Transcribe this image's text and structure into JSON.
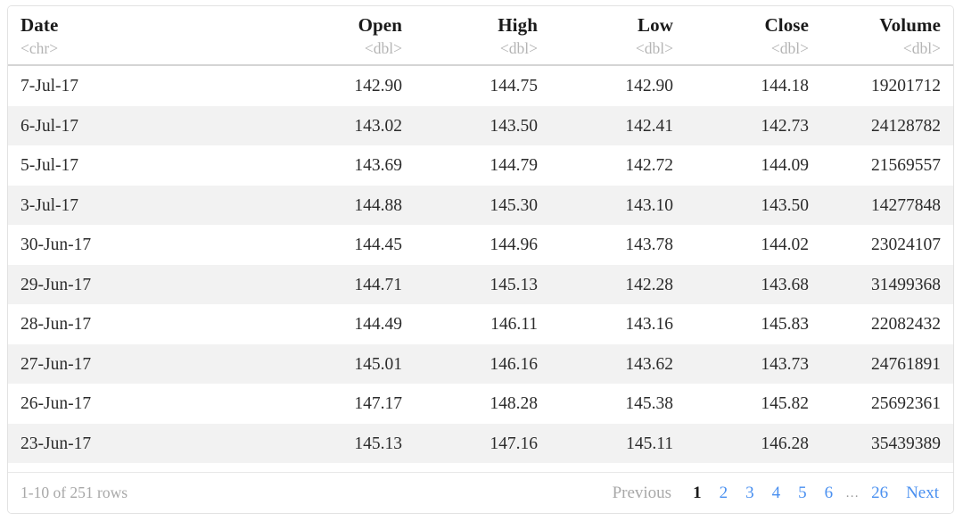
{
  "table": {
    "columns": [
      {
        "label": "Date",
        "type": "<chr>",
        "align": "left",
        "key": "date"
      },
      {
        "label": "Open",
        "type": "<dbl>",
        "align": "right",
        "key": "open"
      },
      {
        "label": "High",
        "type": "<dbl>",
        "align": "right",
        "key": "high"
      },
      {
        "label": "Low",
        "type": "<dbl>",
        "align": "right",
        "key": "low"
      },
      {
        "label": "Close",
        "type": "<dbl>",
        "align": "right",
        "key": "close"
      },
      {
        "label": "Volume",
        "type": "<dbl>",
        "align": "right",
        "key": "volume"
      }
    ],
    "rows": [
      {
        "date": "7-Jul-17",
        "open": "142.90",
        "high": "144.75",
        "low": "142.90",
        "close": "144.18",
        "volume": "19201712"
      },
      {
        "date": "6-Jul-17",
        "open": "143.02",
        "high": "143.50",
        "low": "142.41",
        "close": "142.73",
        "volume": "24128782"
      },
      {
        "date": "5-Jul-17",
        "open": "143.69",
        "high": "144.79",
        "low": "142.72",
        "close": "144.09",
        "volume": "21569557"
      },
      {
        "date": "3-Jul-17",
        "open": "144.88",
        "high": "145.30",
        "low": "143.10",
        "close": "143.50",
        "volume": "14277848"
      },
      {
        "date": "30-Jun-17",
        "open": "144.45",
        "high": "144.96",
        "low": "143.78",
        "close": "144.02",
        "volume": "23024107"
      },
      {
        "date": "29-Jun-17",
        "open": "144.71",
        "high": "145.13",
        "low": "142.28",
        "close": "143.68",
        "volume": "31499368"
      },
      {
        "date": "28-Jun-17",
        "open": "144.49",
        "high": "146.11",
        "low": "143.16",
        "close": "145.83",
        "volume": "22082432"
      },
      {
        "date": "27-Jun-17",
        "open": "145.01",
        "high": "146.16",
        "low": "143.62",
        "close": "143.73",
        "volume": "24761891"
      },
      {
        "date": "26-Jun-17",
        "open": "147.17",
        "high": "148.28",
        "low": "145.38",
        "close": "145.82",
        "volume": "25692361"
      },
      {
        "date": "23-Jun-17",
        "open": "145.13",
        "high": "147.16",
        "low": "145.11",
        "close": "146.28",
        "volume": "35439389"
      }
    ]
  },
  "footer": {
    "row_info": "1-10 of 251 rows",
    "previous_label": "Previous",
    "next_label": "Next",
    "ellipsis": "…",
    "current_page": "1",
    "pages": [
      "1",
      "2",
      "3",
      "4",
      "5",
      "6"
    ],
    "last_page": "26"
  },
  "colors": {
    "link": "#4a90f0",
    "muted": "#a8a8a8",
    "text": "#2b2b2b",
    "header_text": "#1a1a1a",
    "type_hint": "#b4b4b4",
    "stripe": "#f2f2f2",
    "border": "#e2e2e2",
    "header_rule": "#d5d5d5"
  }
}
